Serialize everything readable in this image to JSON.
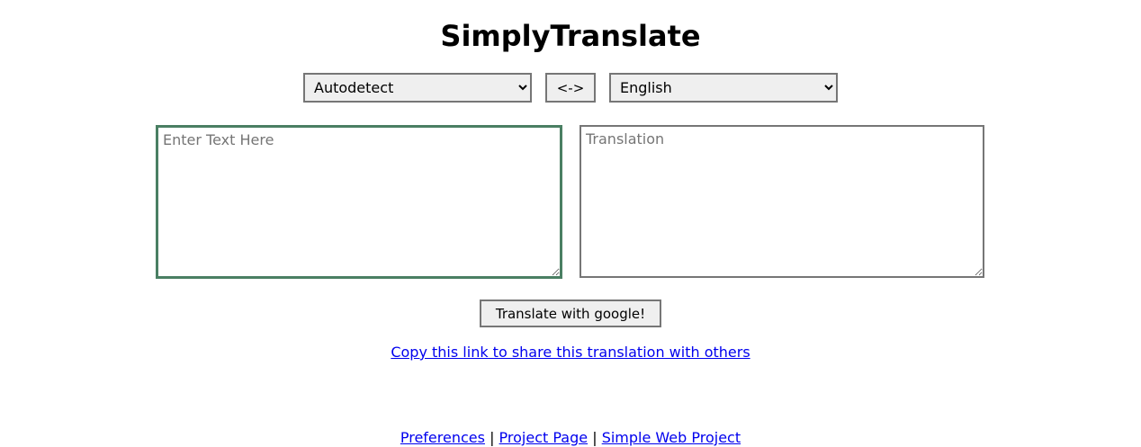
{
  "header": {
    "title": "SimplyTranslate"
  },
  "language_bar": {
    "from_selected": "Autodetect",
    "swap_label": "<->",
    "to_selected": "English"
  },
  "input": {
    "placeholder": "Enter Text Here",
    "value": ""
  },
  "output": {
    "placeholder": "Translation",
    "value": ""
  },
  "translate_button": {
    "label": "Translate with google!"
  },
  "share": {
    "link_text": "Copy this link to share this translation with others"
  },
  "footer": {
    "links": [
      "Preferences",
      "Project Page",
      "Simple Web Project"
    ],
    "separator": "|"
  },
  "colors": {
    "focus_border": "#4a7f63",
    "link": "#0000ee"
  }
}
